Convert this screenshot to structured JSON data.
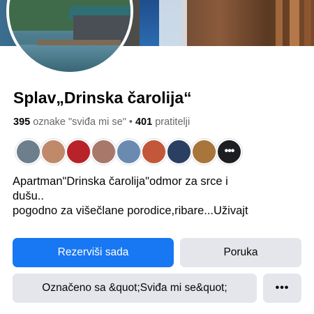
{
  "page": {
    "name": "Splav„Drinska čarolija“",
    "likes_count": "395",
    "likes_label": "oznake \"sviđa mi se\"",
    "separator": "•",
    "followers_count": "401",
    "followers_label": "pratitelji"
  },
  "friends": {
    "more_label": "•••",
    "colors": [
      "#6d7f8c",
      "#c08a6a",
      "#b8232a",
      "#a8786a",
      "#6a8ab0",
      "#c2573a",
      "#2b3f63",
      "#a8763a"
    ]
  },
  "bio": {
    "line1": "Apartman\"Drinska čarolija\"odmor za srce i",
    "line2": "dušu..",
    "line3": "pogodno za višečlane porodice,ribare...Uživajt"
  },
  "actions": {
    "book_label": "Rezerviši sada",
    "message_label": "Poruka",
    "liked_label": "Označeno sa &quot;Sviđa mi se&quot;",
    "more_label": "•••"
  },
  "colors": {
    "accent": "#1877f2",
    "secondary_button": "#e4e6eb",
    "muted_text": "#65676b"
  }
}
